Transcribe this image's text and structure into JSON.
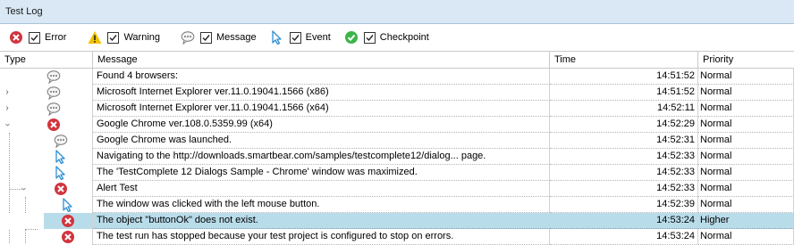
{
  "panel_title": "Test Log",
  "filters": [
    {
      "label": "Error",
      "icon": "error-icon",
      "checked": true
    },
    {
      "label": "Warning",
      "icon": "warning-icon",
      "checked": true
    },
    {
      "label": "Message",
      "icon": "message-icon",
      "checked": true
    },
    {
      "label": "Event",
      "icon": "event-icon",
      "checked": true
    },
    {
      "label": "Checkpoint",
      "icon": "checkpoint-icon",
      "checked": true
    }
  ],
  "columns": {
    "type": "Type",
    "message": "Message",
    "time": "Time",
    "priority": "Priority"
  },
  "rows": [
    {
      "message": "Found 4 browsers:",
      "time": "14:51:52",
      "priority": "Normal",
      "icon": "message-icon"
    },
    {
      "message": "Microsoft Internet Explorer ver.11.0.19041.1566 (x86)",
      "time": "14:51:52",
      "priority": "Normal",
      "icon": "message-icon",
      "toggle": "collapsed"
    },
    {
      "message": "Microsoft Internet Explorer ver.11.0.19041.1566 (x64)",
      "time": "14:52:11",
      "priority": "Normal",
      "icon": "message-icon",
      "toggle": "collapsed"
    },
    {
      "message": "Google Chrome ver.108.0.5359.99 (x64)",
      "time": "14:52:29",
      "priority": "Normal",
      "icon": "error-icon",
      "toggle": "expanded"
    },
    {
      "message": "Google Chrome was launched.",
      "time": "14:52:31",
      "priority": "Normal",
      "icon": "message-icon"
    },
    {
      "message": "Navigating to the http://downloads.smartbear.com/samples/testcomplete12/dialog... page.",
      "time": "14:52:33",
      "priority": "Normal",
      "icon": "event-icon"
    },
    {
      "message": "The 'TestComplete 12 Dialogs Sample - Chrome' window was maximized.",
      "time": "14:52:33",
      "priority": "Normal",
      "icon": "event-icon"
    },
    {
      "message": "Alert Test",
      "time": "14:52:33",
      "priority": "Normal",
      "icon": "error-icon",
      "toggle": "expanded"
    },
    {
      "message": "The window was clicked with the left mouse button.",
      "time": "14:52:39",
      "priority": "Normal",
      "icon": "event-icon"
    },
    {
      "message": "The object \"buttonOk\" does not exist.",
      "time": "14:53:24",
      "priority": "Higher",
      "icon": "error-icon",
      "selected": true
    },
    {
      "message": "The test run has stopped because your test project is configured to stop on errors.",
      "time": "14:53:24",
      "priority": "Normal",
      "icon": "error-icon"
    }
  ],
  "colors": {
    "title_bg": "#d9e8f4",
    "selected_row": "#b9dcea",
    "error": "#d1343e",
    "warning": "#f2c200",
    "event": "#2f8fd3",
    "checkpoint": "#3cb44b"
  }
}
